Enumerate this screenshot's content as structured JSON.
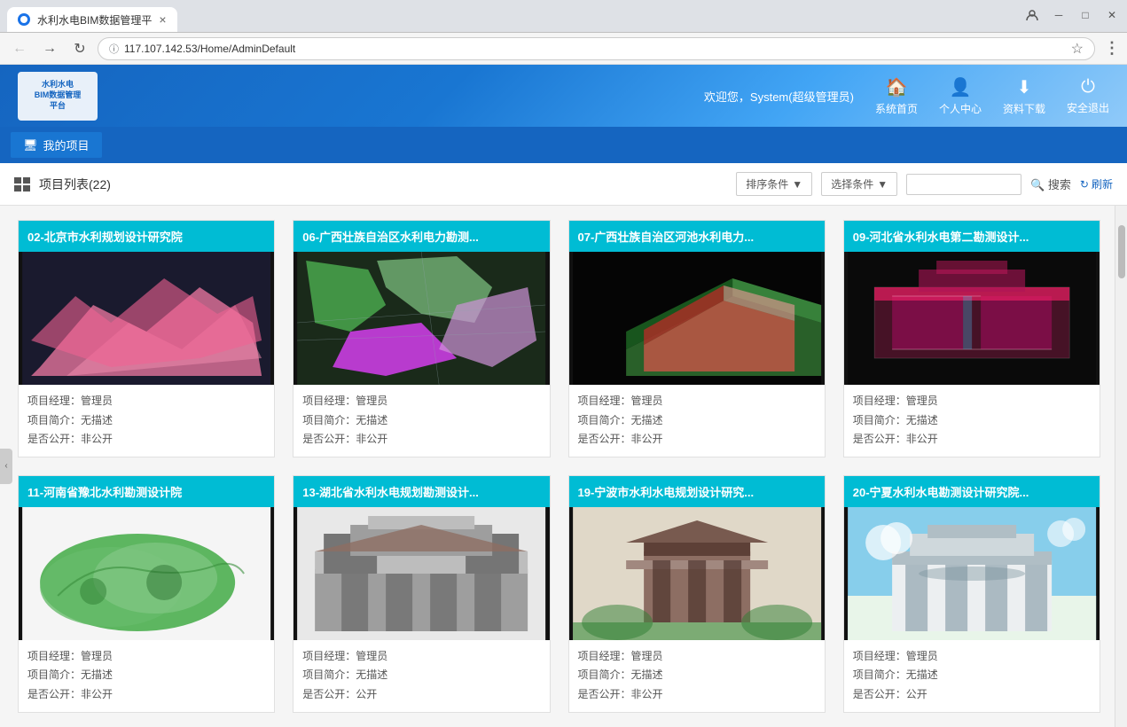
{
  "browser": {
    "tab_title": "水利水电BIM数据管理平",
    "address": "117.107.142.53/Home/AdminDefault",
    "refresh_label": "C",
    "back_label": "←",
    "forward_label": "→"
  },
  "header": {
    "logo_line1": "水利水电",
    "logo_line2": "BIM数据管理",
    "logo_line3": "平台",
    "welcome": "欢迎您，System(超级管理员)",
    "home_label": "系统首页",
    "profile_label": "个人中心",
    "download_label": "资料下载",
    "logout_label": "安全退出"
  },
  "sidebar": {
    "my_project_label": "我的项目"
  },
  "toolbar": {
    "project_list_label": "项目列表(22)",
    "sort_label": "排序条件",
    "filter_label": "选择条件",
    "search_placeholder": "",
    "search_btn_label": "搜索",
    "refresh_label": "刷新"
  },
  "projects": [
    {
      "id": "02",
      "title": "02-北京市水利规划设计研究院",
      "manager": "管理员",
      "desc": "无描述",
      "public": "非公开",
      "img_type": "map-pink"
    },
    {
      "id": "06",
      "title": "06-广西壮族自治区水利电力勘测...",
      "manager": "管理员",
      "desc": "无描述",
      "public": "非公开",
      "img_type": "map-green-pink"
    },
    {
      "id": "07",
      "title": "07-广西壮族自治区河池水利电力...",
      "manager": "管理员",
      "desc": "无描述",
      "public": "非公开",
      "img_type": "building-3d-dark"
    },
    {
      "id": "09",
      "title": "09-河北省水利水电第二勘测设计...",
      "manager": "管理员",
      "desc": "无描述",
      "public": "非公开",
      "img_type": "building-aerial-pink"
    },
    {
      "id": "11",
      "title": "11-河南省豫北水利勘测设计院",
      "manager": "管理员",
      "desc": "无描述",
      "public": "非公开",
      "img_type": "map-green"
    },
    {
      "id": "13",
      "title": "13-湖北省水利水电规划勘测设计...",
      "manager": "管理员",
      "desc": "无描述",
      "public": "公开",
      "img_type": "building-gray"
    },
    {
      "id": "19",
      "title": "19-宁波市水利水电规划设计研究...",
      "manager": "管理员",
      "desc": "无描述",
      "public": "非公开",
      "img_type": "building-modern"
    },
    {
      "id": "20",
      "title": "20-宁夏水利水电勘测设计研究院...",
      "manager": "管理员",
      "desc": "无描述",
      "public": "公开",
      "img_type": "building-blue-sky"
    }
  ],
  "labels": {
    "manager_prefix": "项目经理：",
    "desc_prefix": "项目简介：",
    "public_prefix": "是否公开："
  }
}
